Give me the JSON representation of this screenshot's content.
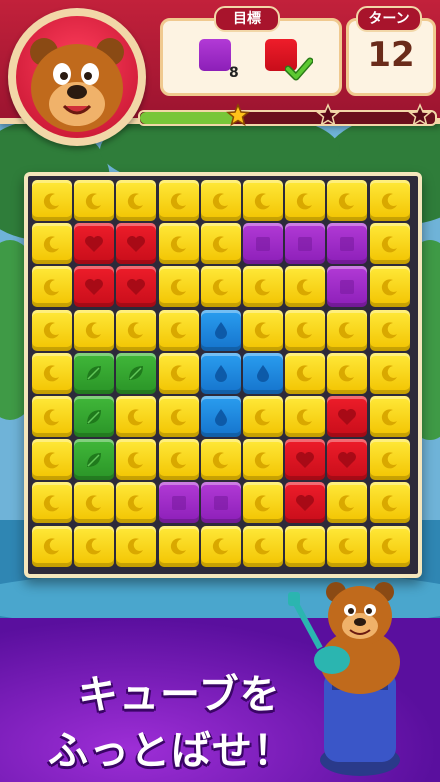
{
  "header": {
    "goal_label": "目標",
    "turn_label": "ターン",
    "turns_left": "12"
  },
  "goals": [
    {
      "color": "#9b2bc8",
      "icon": "purple-cube",
      "remaining": "8"
    },
    {
      "color": "#e0152a",
      "icon": "red-cube",
      "remaining": "",
      "completed": true
    }
  ],
  "progress": {
    "fraction": 0.33,
    "stars": 3,
    "stars_earned": 1
  },
  "board": {
    "rows": 9,
    "cols": 9,
    "grid": [
      [
        "Y",
        "Y",
        "Y",
        "Y",
        "Y",
        "Y",
        "Y",
        "Y",
        "Y"
      ],
      [
        "Y",
        "R",
        "R",
        "Y",
        "Y",
        "P",
        "P",
        "P",
        "Y"
      ],
      [
        "Y",
        "R",
        "R",
        "Y",
        "Y",
        "Y",
        "Y",
        "P",
        "Y"
      ],
      [
        "Y",
        "Y",
        "Y",
        "Y",
        "B",
        "Y",
        "Y",
        "Y",
        "Y"
      ],
      [
        "Y",
        "G",
        "G",
        "Y",
        "B",
        "B",
        "Y",
        "Y",
        "Y"
      ],
      [
        "Y",
        "G",
        "Y",
        "Y",
        "B",
        "Y",
        "Y",
        "R",
        "Y"
      ],
      [
        "Y",
        "G",
        "Y",
        "Y",
        "Y",
        "Y",
        "R",
        "R",
        "Y"
      ],
      [
        "Y",
        "Y",
        "Y",
        "P",
        "P",
        "Y",
        "R",
        "Y",
        "Y"
      ],
      [
        "Y",
        "Y",
        "Y",
        "Y",
        "Y",
        "Y",
        "Y",
        "Y",
        "Y"
      ]
    ],
    "tile_icons": {
      "Y": "moon-icon",
      "R": "heart-icon",
      "P": "square-icon",
      "G": "leaf-icon",
      "B": "drop-icon"
    }
  },
  "promo": {
    "line1": "キューブを",
    "line2": "ふっとばせ！"
  }
}
